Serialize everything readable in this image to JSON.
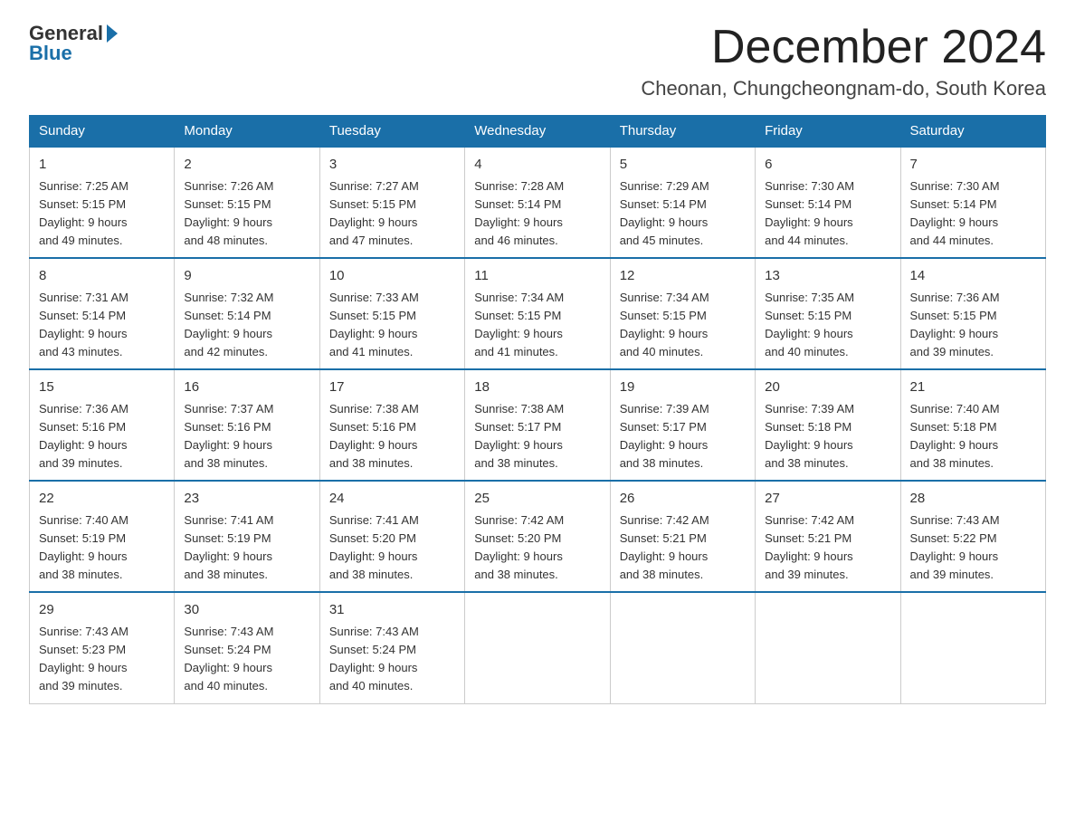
{
  "header": {
    "logo_general": "General",
    "logo_blue": "Blue",
    "month_title": "December 2024",
    "location": "Cheonan, Chungcheongnam-do, South Korea"
  },
  "weekdays": [
    "Sunday",
    "Monday",
    "Tuesday",
    "Wednesday",
    "Thursday",
    "Friday",
    "Saturday"
  ],
  "weeks": [
    [
      {
        "day": "1",
        "sunrise": "7:25 AM",
        "sunset": "5:15 PM",
        "daylight": "9 hours and 49 minutes."
      },
      {
        "day": "2",
        "sunrise": "7:26 AM",
        "sunset": "5:15 PM",
        "daylight": "9 hours and 48 minutes."
      },
      {
        "day": "3",
        "sunrise": "7:27 AM",
        "sunset": "5:15 PM",
        "daylight": "9 hours and 47 minutes."
      },
      {
        "day": "4",
        "sunrise": "7:28 AM",
        "sunset": "5:14 PM",
        "daylight": "9 hours and 46 minutes."
      },
      {
        "day": "5",
        "sunrise": "7:29 AM",
        "sunset": "5:14 PM",
        "daylight": "9 hours and 45 minutes."
      },
      {
        "day": "6",
        "sunrise": "7:30 AM",
        "sunset": "5:14 PM",
        "daylight": "9 hours and 44 minutes."
      },
      {
        "day": "7",
        "sunrise": "7:30 AM",
        "sunset": "5:14 PM",
        "daylight": "9 hours and 44 minutes."
      }
    ],
    [
      {
        "day": "8",
        "sunrise": "7:31 AM",
        "sunset": "5:14 PM",
        "daylight": "9 hours and 43 minutes."
      },
      {
        "day": "9",
        "sunrise": "7:32 AM",
        "sunset": "5:14 PM",
        "daylight": "9 hours and 42 minutes."
      },
      {
        "day": "10",
        "sunrise": "7:33 AM",
        "sunset": "5:15 PM",
        "daylight": "9 hours and 41 minutes."
      },
      {
        "day": "11",
        "sunrise": "7:34 AM",
        "sunset": "5:15 PM",
        "daylight": "9 hours and 41 minutes."
      },
      {
        "day": "12",
        "sunrise": "7:34 AM",
        "sunset": "5:15 PM",
        "daylight": "9 hours and 40 minutes."
      },
      {
        "day": "13",
        "sunrise": "7:35 AM",
        "sunset": "5:15 PM",
        "daylight": "9 hours and 40 minutes."
      },
      {
        "day": "14",
        "sunrise": "7:36 AM",
        "sunset": "5:15 PM",
        "daylight": "9 hours and 39 minutes."
      }
    ],
    [
      {
        "day": "15",
        "sunrise": "7:36 AM",
        "sunset": "5:16 PM",
        "daylight": "9 hours and 39 minutes."
      },
      {
        "day": "16",
        "sunrise": "7:37 AM",
        "sunset": "5:16 PM",
        "daylight": "9 hours and 38 minutes."
      },
      {
        "day": "17",
        "sunrise": "7:38 AM",
        "sunset": "5:16 PM",
        "daylight": "9 hours and 38 minutes."
      },
      {
        "day": "18",
        "sunrise": "7:38 AM",
        "sunset": "5:17 PM",
        "daylight": "9 hours and 38 minutes."
      },
      {
        "day": "19",
        "sunrise": "7:39 AM",
        "sunset": "5:17 PM",
        "daylight": "9 hours and 38 minutes."
      },
      {
        "day": "20",
        "sunrise": "7:39 AM",
        "sunset": "5:18 PM",
        "daylight": "9 hours and 38 minutes."
      },
      {
        "day": "21",
        "sunrise": "7:40 AM",
        "sunset": "5:18 PM",
        "daylight": "9 hours and 38 minutes."
      }
    ],
    [
      {
        "day": "22",
        "sunrise": "7:40 AM",
        "sunset": "5:19 PM",
        "daylight": "9 hours and 38 minutes."
      },
      {
        "day": "23",
        "sunrise": "7:41 AM",
        "sunset": "5:19 PM",
        "daylight": "9 hours and 38 minutes."
      },
      {
        "day": "24",
        "sunrise": "7:41 AM",
        "sunset": "5:20 PM",
        "daylight": "9 hours and 38 minutes."
      },
      {
        "day": "25",
        "sunrise": "7:42 AM",
        "sunset": "5:20 PM",
        "daylight": "9 hours and 38 minutes."
      },
      {
        "day": "26",
        "sunrise": "7:42 AM",
        "sunset": "5:21 PM",
        "daylight": "9 hours and 38 minutes."
      },
      {
        "day": "27",
        "sunrise": "7:42 AM",
        "sunset": "5:21 PM",
        "daylight": "9 hours and 39 minutes."
      },
      {
        "day": "28",
        "sunrise": "7:43 AM",
        "sunset": "5:22 PM",
        "daylight": "9 hours and 39 minutes."
      }
    ],
    [
      {
        "day": "29",
        "sunrise": "7:43 AM",
        "sunset": "5:23 PM",
        "daylight": "9 hours and 39 minutes."
      },
      {
        "day": "30",
        "sunrise": "7:43 AM",
        "sunset": "5:24 PM",
        "daylight": "9 hours and 40 minutes."
      },
      {
        "day": "31",
        "sunrise": "7:43 AM",
        "sunset": "5:24 PM",
        "daylight": "9 hours and 40 minutes."
      },
      null,
      null,
      null,
      null
    ]
  ]
}
